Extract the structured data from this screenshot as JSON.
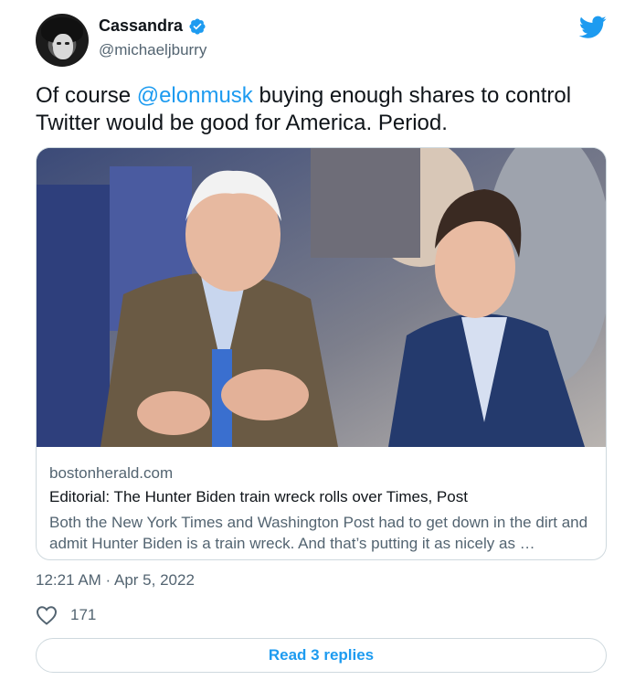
{
  "author": {
    "name": "Cassandra",
    "handle": "@michaeljburry",
    "verified": true
  },
  "tweet": {
    "mention": "@elonmusk",
    "text_before": "Of course ",
    "text_after": " buying enough shares to control Twitter would be good for America. Period."
  },
  "card": {
    "domain": "bostonherald.com",
    "title": "Editorial: The Hunter Biden train wreck rolls over Times, Post",
    "description": "Both the New York Times and Washington Post had to get down in the dirt and admit Hunter Biden is a train wreck. And that’s putting it as nicely as …"
  },
  "timestamp": "12:21 AM · Apr 5, 2022",
  "likes": "171",
  "replies_button": "Read 3 replies",
  "colors": {
    "accent": "#1d9bf0",
    "text": "#0f1419",
    "muted": "#536471",
    "border": "#cfd9de"
  },
  "icons": {
    "logo": "twitter-bird-icon",
    "verified": "verified-badge-icon",
    "like": "heart-outline-icon"
  }
}
